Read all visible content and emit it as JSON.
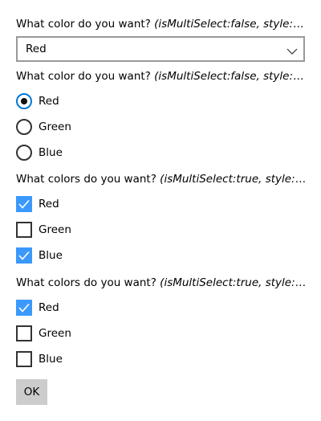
{
  "questions": [
    {
      "prompt": "What color do you want?",
      "hint": "(isMultiSelect:false, style:compact)",
      "selected_value": "Red"
    },
    {
      "prompt": "What color do you want?",
      "hint": "(isMultiSelect:false, style:expanded)",
      "options": [
        {
          "label": "Red",
          "selected": true
        },
        {
          "label": "Green",
          "selected": false
        },
        {
          "label": "Blue",
          "selected": false
        }
      ]
    },
    {
      "prompt": "What colors do you want?",
      "hint": "(isMultiSelect:true, style:compact)",
      "options": [
        {
          "label": "Red",
          "checked": true
        },
        {
          "label": "Green",
          "checked": false
        },
        {
          "label": "Blue",
          "checked": true
        }
      ]
    },
    {
      "prompt": "What colors do you want?",
      "hint": "(isMultiSelect:true, style:expanded)",
      "options": [
        {
          "label": "Red",
          "checked": true
        },
        {
          "label": "Green",
          "checked": false
        },
        {
          "label": "Blue",
          "checked": false
        }
      ]
    }
  ],
  "ok_label": "OK",
  "icons": {
    "dropdown": "chevron-down-icon",
    "check": "checkmark-icon"
  },
  "colors": {
    "accent": "#3b99fc",
    "radio_selected_border": "#0078d7",
    "button_bg": "#cccccc",
    "combo_border": "#999999"
  }
}
